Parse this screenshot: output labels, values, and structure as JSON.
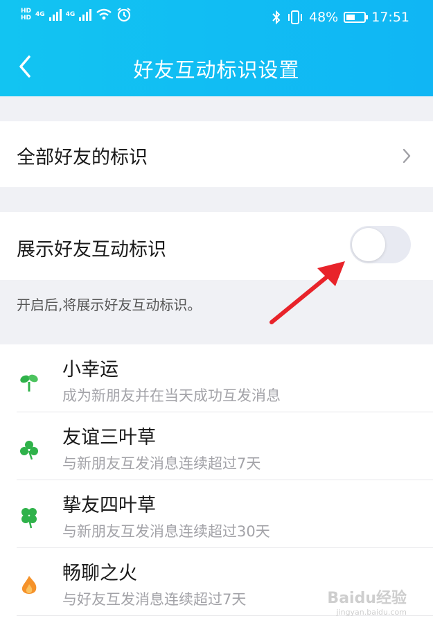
{
  "status_bar": {
    "network_badge_top": "HD",
    "network_badge_bottom": "HD",
    "signal1_label": "4G",
    "signal2_label": "4G",
    "battery_percent": "48%",
    "battery_level": 0.48,
    "time": "17:51"
  },
  "nav": {
    "title": "好友互动标识设置"
  },
  "settings": {
    "all_friends_label": "全部好友的标识",
    "show_label": "展示好友互动标识",
    "show_enabled": false,
    "hint": "开启后,将展示好友互动标识。"
  },
  "badges": [
    {
      "title": "小幸运",
      "desc": "成为新朋友并在当天成功互发消息",
      "icon": "sprout-icon"
    },
    {
      "title": "友谊三叶草",
      "desc": "与新朋友互发消息连续超过7天",
      "icon": "three-leaf-clover-icon"
    },
    {
      "title": "挚友四叶草",
      "desc": "与新朋友互发消息连续超过30天",
      "icon": "four-leaf-clover-icon"
    },
    {
      "title": "畅聊之火",
      "desc": "与好友互发消息连续超过7天",
      "icon": "flame-icon"
    }
  ],
  "colors": {
    "header": "#12c4f2",
    "leaf_green": "#2fb24a",
    "flame_orange": "#f5922a",
    "annotation_red": "#e8232a"
  },
  "watermark": {
    "brand": "Baidu经验",
    "url": "jingyan.baidu.com"
  }
}
